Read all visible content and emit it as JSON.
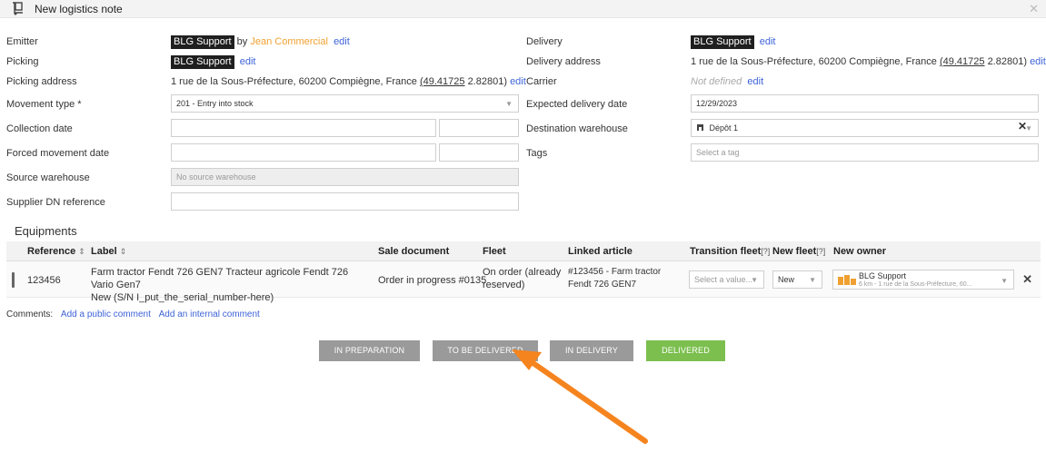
{
  "title": "New logistics note",
  "form": {
    "emitter": {
      "label": "Emitter",
      "tag": "BLG Support",
      "by": "by",
      "person": "Jean Commercial",
      "edit": "edit"
    },
    "picking": {
      "label": "Picking",
      "tag": "BLG Support",
      "edit": "edit"
    },
    "picking_address": {
      "label": "Picking address",
      "address": "1 rue de la Sous-Préfecture, 60200 Compiègne, France",
      "coords_link": "(49.41725",
      "coords_rest": "2.82801)",
      "edit": "edit"
    },
    "movement_type": {
      "label": "Movement type *",
      "value": "201 - Entry into stock"
    },
    "collection_date": {
      "label": "Collection date"
    },
    "forced_movement_date": {
      "label": "Forced movement date"
    },
    "source_warehouse": {
      "label": "Source warehouse",
      "placeholder": "No source warehouse"
    },
    "supplier_dn": {
      "label": "Supplier DN reference"
    },
    "delivery": {
      "label": "Delivery",
      "tag": "BLG Support",
      "edit": "edit"
    },
    "delivery_address": {
      "label": "Delivery address",
      "address": "1 rue de la Sous-Préfecture, 60200 Compiègne, France",
      "coords_link": "(49.41725",
      "coords_rest": "2.82801)",
      "edit": "edit"
    },
    "carrier": {
      "label": "Carrier",
      "value": "Not defined",
      "edit": "edit"
    },
    "expected_delivery_date": {
      "label": "Expected delivery date",
      "value": "12/29/2023"
    },
    "destination_warehouse": {
      "label": "Destination warehouse",
      "value": "Dépôt 1"
    },
    "tags": {
      "label": "Tags",
      "placeholder": "Select a tag"
    }
  },
  "equipments": {
    "title": "Equipments",
    "headers": {
      "reference": "Reference",
      "label": "Label",
      "sale_document": "Sale document",
      "fleet": "Fleet",
      "linked_article": "Linked article",
      "transition_fleet": "Transition fleet",
      "new_fleet": "New fleet",
      "new_owner": "New owner",
      "help": "[?]",
      "sort": "⇕"
    },
    "rows": [
      {
        "reference": "123456",
        "label_line1": "Farm tractor Fendt 726 GEN7 Tracteur agricole Fendt 726 Vario Gen7",
        "label_line2": "New (S/N I_put_the_serial_number-here)",
        "sale_document": "Order in progress #0135",
        "fleet_line1": "On order (already",
        "fleet_line2": "reserved)",
        "linked_line1": "#123456 - Farm tractor",
        "linked_line2": "Fendt 726 GEN7",
        "transition_placeholder": "Select a value...",
        "new_fleet": "New",
        "owner_name": "BLG Support",
        "owner_sub": "6 km - 1 rue de la Sous-Préfecture, 60..."
      }
    ]
  },
  "comments": {
    "label": "Comments:",
    "public": "Add a public comment",
    "internal": "Add an internal comment"
  },
  "steps": [
    "IN PREPARATION",
    "TO BE DELIVERED",
    "IN DELIVERY",
    "DELIVERED"
  ],
  "colors": {
    "orange_link": "#f0a030",
    "blue_link": "#3d63d8",
    "step_grey": "#9a9a9a",
    "step_green": "#7cbf4f",
    "arrow": "#f5841f"
  }
}
